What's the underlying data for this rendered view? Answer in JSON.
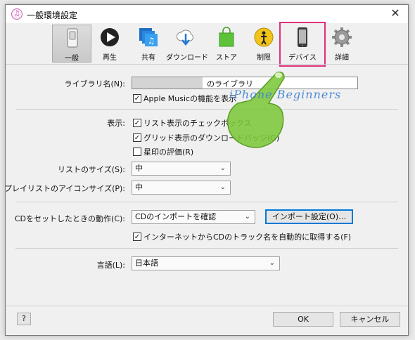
{
  "window": {
    "title": "一般環境設定",
    "close_glyph": "✕",
    "app_icon_glyph": "♫"
  },
  "toolbar": {
    "items": [
      {
        "label": "一般",
        "icon": "switch-icon"
      },
      {
        "label": "再生",
        "icon": "play-icon"
      },
      {
        "label": "共有",
        "icon": "shared-music-icon"
      },
      {
        "label": "ダウンロード",
        "icon": "cloud-download-icon"
      },
      {
        "label": "ストア",
        "icon": "store-bag-icon"
      },
      {
        "label": "制限",
        "icon": "parental-restriction-icon"
      },
      {
        "label": "デバイス",
        "icon": "iphone-icon"
      },
      {
        "label": "詳細",
        "icon": "gear-icon"
      }
    ],
    "selected": "一般"
  },
  "library": {
    "label": "ライブラリ名(N):",
    "value": "のライブラリ",
    "apple_music_label": "Apple Musicの機能を表示",
    "apple_music_checked": true
  },
  "display": {
    "label": "表示:",
    "options": [
      {
        "text": "リスト表示のチェックボックス",
        "checked": true
      },
      {
        "text": "グリッド表示のダウンロードバッジ(G)",
        "checked": true
      },
      {
        "text": "星印の評価(R)",
        "checked": false
      }
    ],
    "check_glyph": "✓"
  },
  "list_size": {
    "label": "リストのサイズ(S):",
    "value": "中"
  },
  "playlist_icon_size": {
    "label": "プレイリストのアイコンサイズ(P):",
    "value": "中"
  },
  "cd": {
    "label": "CDをセットしたときの動作(C):",
    "value": "CDのインポートを確認",
    "import_settings_label": "インポート設定(O)…",
    "auto_name_label": "インターネットからCDのトラック名を自動的に取得する(F)",
    "auto_name_checked": true
  },
  "language": {
    "label": "言語(L):",
    "value": "日本語"
  },
  "footer": {
    "help_label": "?",
    "ok_label": "OK",
    "cancel_label": "キャンセル"
  },
  "watermark": "iPhone Beginners",
  "colors": {
    "highlight": "#e0307c",
    "focus": "#0078d7",
    "finger": "#7bc73a"
  }
}
